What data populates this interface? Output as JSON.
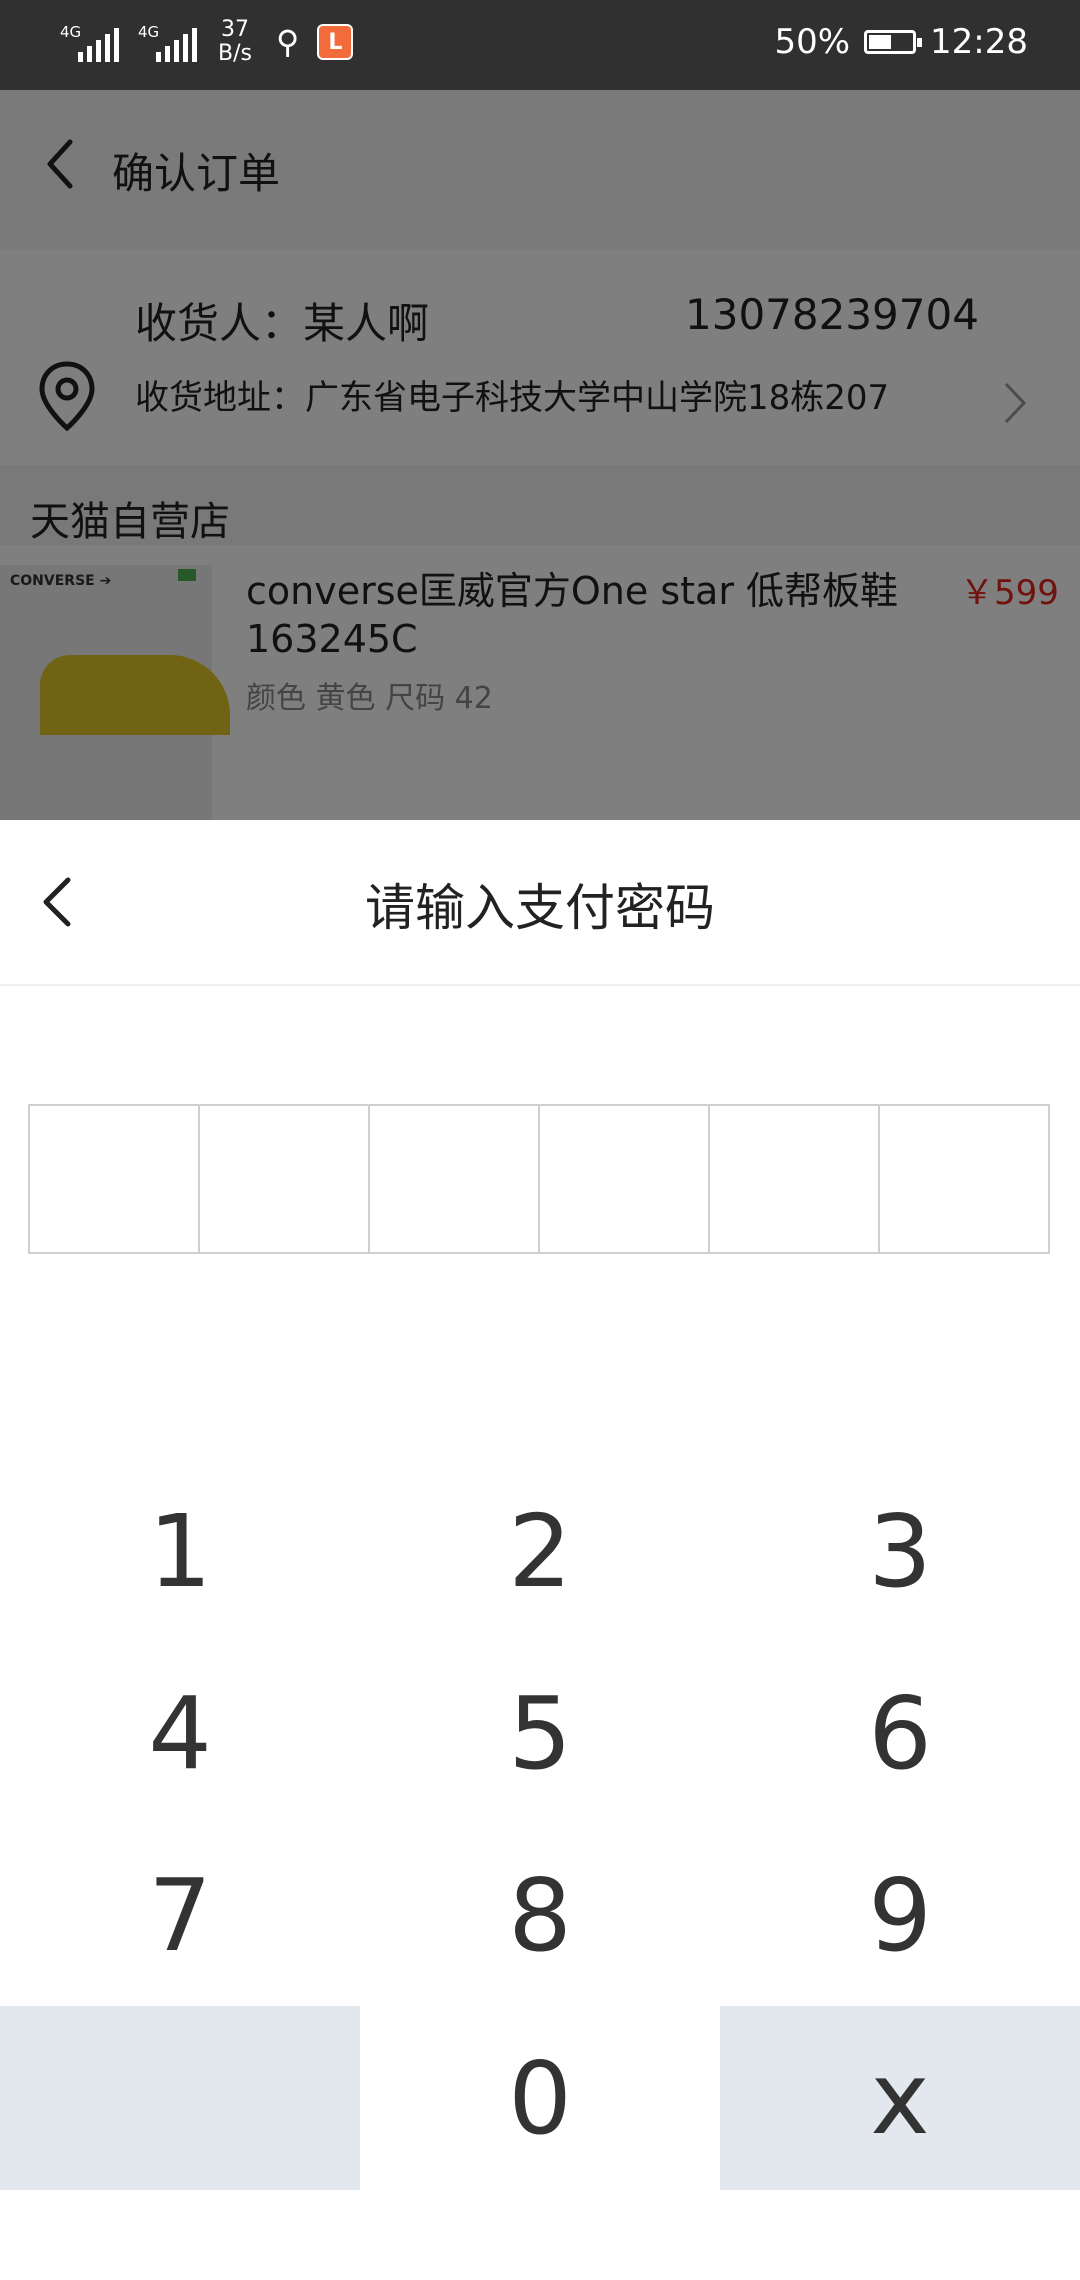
{
  "status_bar": {
    "network1": "4G",
    "network2": "4G",
    "speed_value": "37",
    "speed_unit": "B/s",
    "battery": "50%",
    "time": "12:28",
    "app_icon_glyph": "L",
    "usb_icon": "usb-icon",
    "app_icon": "app-notification-icon"
  },
  "header": {
    "title": "确认订单"
  },
  "address": {
    "recipient": "收货人：某人啊",
    "phone": "13078239704",
    "address": "收货地址：广东省电子科技大学中山学院18栋207"
  },
  "shop": {
    "name": "天猫自营店"
  },
  "product": {
    "brand": "CONVERSE ➔",
    "title": "converse匡威官方One star 低帮板鞋 163245C",
    "price": "￥599",
    "spec": "颜色 黄色 尺码 42"
  },
  "payment_sheet": {
    "title": "请输入支付密码",
    "digits_entered": 0,
    "digit_slots": 6
  },
  "keypad": {
    "k1": "1",
    "k2": "2",
    "k3": "3",
    "k4": "4",
    "k5": "5",
    "k6": "6",
    "k7": "7",
    "k8": "8",
    "k9": "9",
    "k0": "0",
    "del": "x"
  },
  "colors": {
    "price_red": "#e0241a",
    "keypad_gray": "#e3e7ee",
    "status_bar": "#303030"
  }
}
